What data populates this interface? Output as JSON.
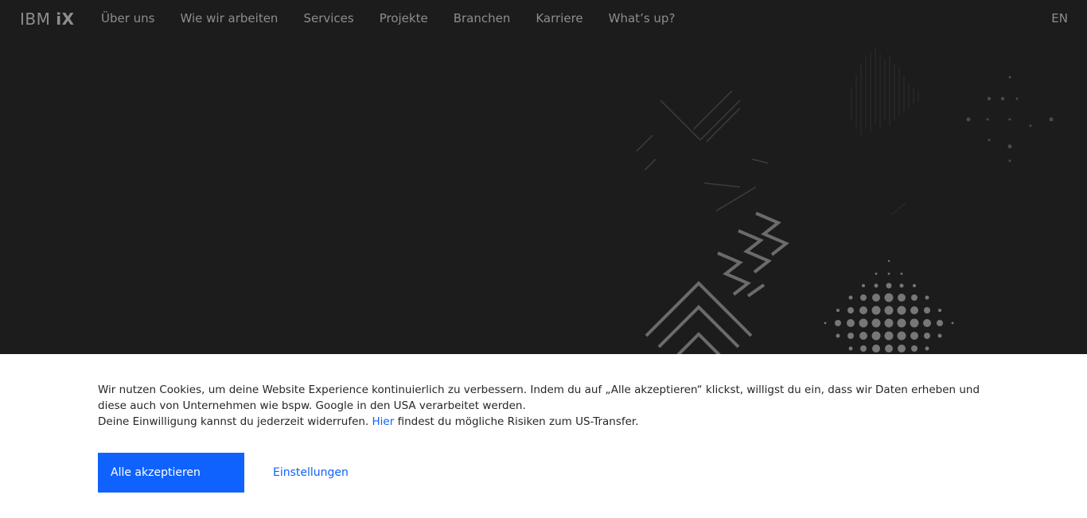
{
  "header": {
    "logo_prefix": "IBM",
    "logo_suffix": "iX",
    "nav": [
      {
        "label": "Über uns"
      },
      {
        "label": "Wie wir arbeiten"
      },
      {
        "label": "Services"
      },
      {
        "label": "Projekte"
      },
      {
        "label": "Branchen"
      },
      {
        "label": "Karriere"
      },
      {
        "label": "What’s up?"
      }
    ],
    "language": "EN"
  },
  "cookie": {
    "text_line1": "Wir nutzen Cookies, um deine Website Experience kontinuierlich zu verbessern. Indem du auf „Alle akzeptieren“ klickst, willigst du ein, dass wir Daten erheben und diese auch von Unternehmen wie bspw. Google in den USA verarbeitet werden.",
    "text_line2_before": "Deine Einwilligung kannst du jederzeit widerrufen.",
    "link_label": "Hier",
    "text_line2_after": "findest du mögliche Risiken zum US-Transfer.",
    "accept_label": "Alle akzeptieren",
    "settings_label": "Einstellungen"
  },
  "colors": {
    "background": "#1c1c1c",
    "nav_text": "#8d8d8d",
    "accent": "#0f62fe",
    "banner": "#ffffff"
  }
}
